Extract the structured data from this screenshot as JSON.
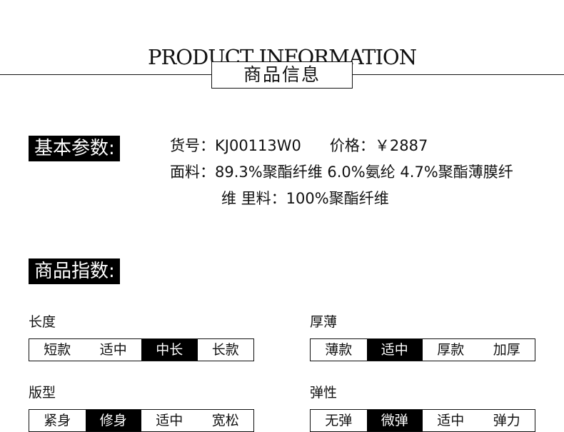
{
  "header": {
    "title_en": "PRODUCT INFORMATION",
    "title_cn": "商品信息"
  },
  "basic": {
    "label": "基本参数:",
    "item_no_label": "货号：",
    "item_no": "KJ00113W0",
    "price_label": "价格：",
    "price": "￥2887",
    "fabric_line1": "面料：89.3%聚酯纤维 6.0%氨纶 4.7%聚酯薄膜纤",
    "fabric_line2": "维 里料：100%聚酯纤维"
  },
  "index": {
    "label": "商品指数:",
    "length": {
      "title": "长度",
      "options": [
        "短款",
        "适中",
        "中长",
        "长款"
      ],
      "selected": "中长"
    },
    "thickness": {
      "title": "厚薄",
      "options": [
        "薄款",
        "适中",
        "厚款",
        "加厚"
      ],
      "selected": "适中"
    },
    "fit": {
      "title": "版型",
      "options": [
        "紧身",
        "修身",
        "适中",
        "宽松"
      ],
      "selected": "修身"
    },
    "elasticity": {
      "title": "弹性",
      "options": [
        "无弹",
        "微弹",
        "适中",
        "弹力"
      ],
      "selected": "微弹"
    }
  }
}
